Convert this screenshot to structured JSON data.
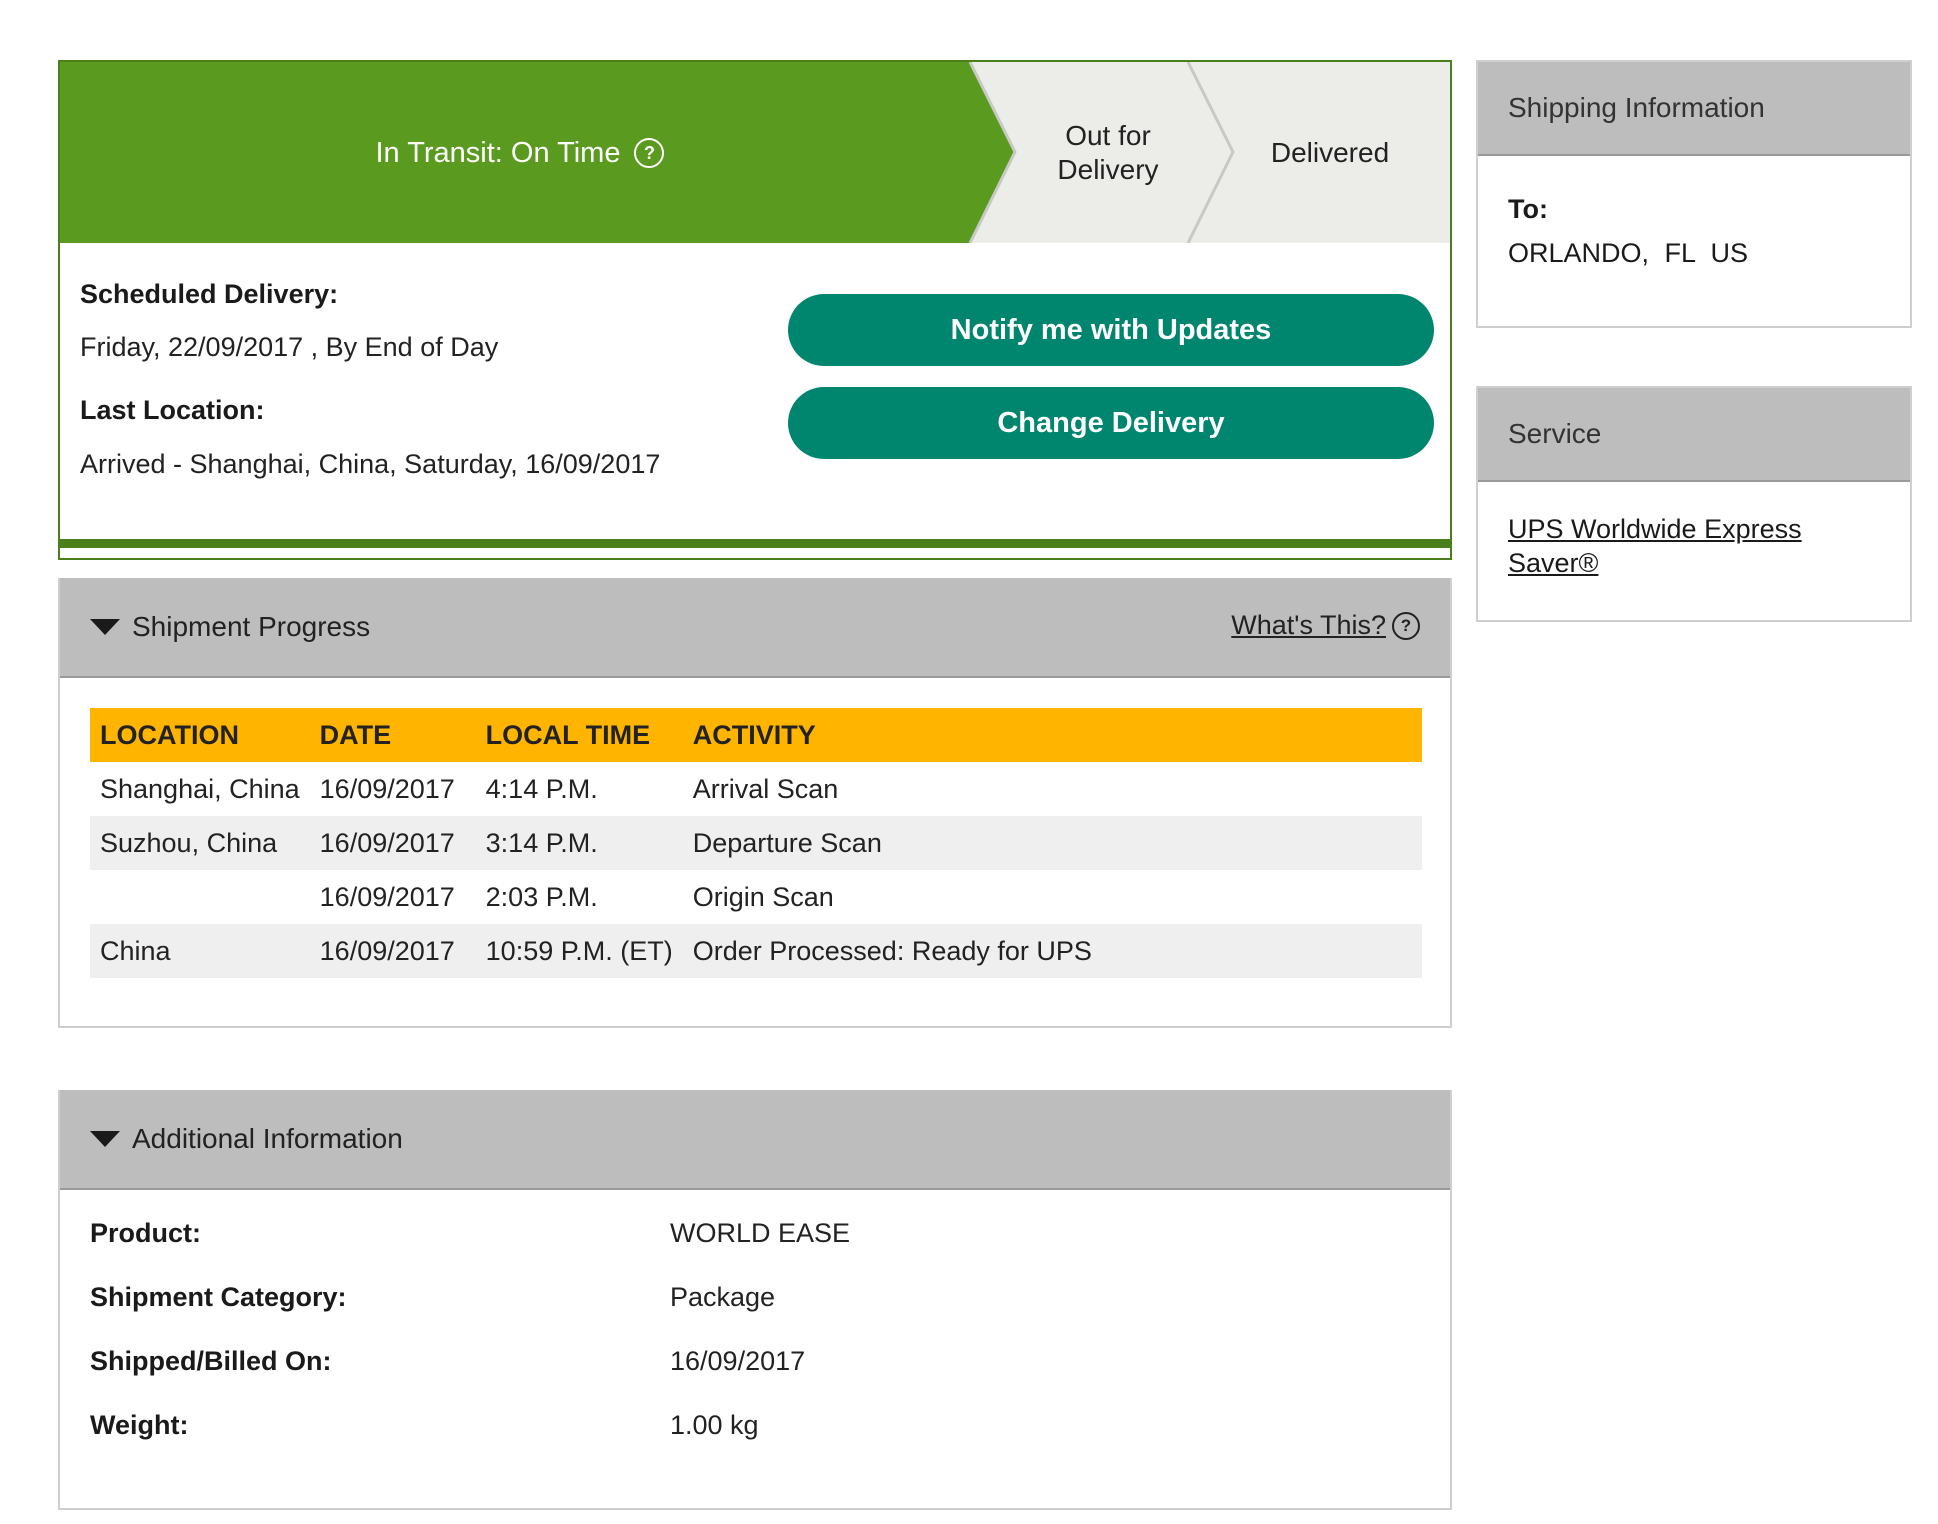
{
  "status": {
    "stages": [
      {
        "label": "In Transit: On Time",
        "active": true
      },
      {
        "label_line1": "Out for",
        "label_line2": "Delivery",
        "active": false
      },
      {
        "label": "Delivered",
        "active": false
      }
    ],
    "help_symbol": "?",
    "scheduled_delivery_label": "Scheduled Delivery:",
    "scheduled_delivery_value": "Friday, 22/09/2017 , By End of Day",
    "last_location_label": "Last Location:",
    "last_location_value": "Arrived - Shanghai, China, Saturday, 16/09/2017",
    "notify_button": "Notify me with Updates",
    "change_button": "Change Delivery",
    "colors": {
      "active": "#5a9a1e",
      "inactive": "#ecece8",
      "button": "#00856f"
    }
  },
  "shipping_info": {
    "title": "Shipping Information",
    "to_label": "To:",
    "to_value": "ORLANDO, FL US"
  },
  "service": {
    "title": "Service",
    "link_line1": "UPS Worldwide Express",
    "link_line2": "Saver®"
  },
  "progress": {
    "title": "Shipment Progress",
    "whats_this": "What's This?",
    "columns": [
      "LOCATION",
      "DATE",
      "LOCAL TIME",
      "ACTIVITY"
    ],
    "rows": [
      {
        "location": "Shanghai,  China",
        "date": "16/09/2017",
        "time": "4:14 P.M.",
        "activity": "Arrival Scan"
      },
      {
        "location": "Suzhou,  China",
        "date": "16/09/2017",
        "time": "3:14 P.M.",
        "activity": "Departure Scan"
      },
      {
        "location": "",
        "date": "16/09/2017",
        "time": "2:03 P.M.",
        "activity": "Origin Scan"
      },
      {
        "location": "China",
        "date": "16/09/2017",
        "time": "10:59 P.M. (ET)",
        "activity": "Order Processed: Ready for UPS"
      }
    ],
    "header_color": "#ffb500"
  },
  "additional": {
    "title": "Additional Information",
    "rows": [
      {
        "label": "Product:",
        "value": "WORLD EASE"
      },
      {
        "label": "Shipment Category:",
        "value": "Package"
      },
      {
        "label": "Shipped/Billed On:",
        "value": "16/09/2017"
      },
      {
        "label": "Weight:",
        "value": "1.00 kg"
      }
    ]
  }
}
